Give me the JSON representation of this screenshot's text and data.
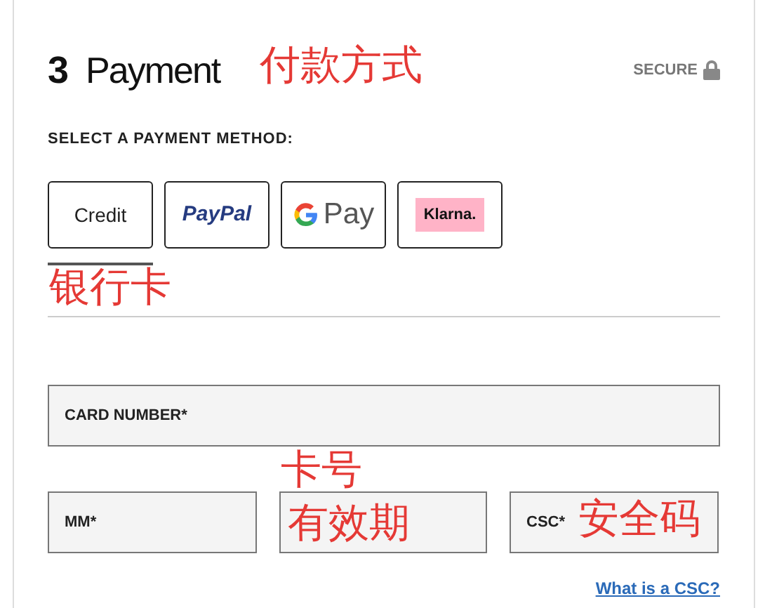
{
  "section": {
    "step": "3",
    "title": "Payment",
    "secure_label": "SECURE"
  },
  "method_prompt": "SELECT A PAYMENT METHOD:",
  "methods": [
    {
      "kind": "credit",
      "label": "Credit",
      "selected": true
    },
    {
      "kind": "paypal",
      "label": "PayPal",
      "selected": false
    },
    {
      "kind": "gpay",
      "label": "Pay",
      "selected": false
    },
    {
      "kind": "klarna",
      "label": "Klarna.",
      "selected": false
    }
  ],
  "fields": {
    "card_number": {
      "placeholder": "CARD NUMBER*"
    },
    "month": {
      "placeholder": "MM*"
    },
    "cvc": {
      "placeholder": "CSC*"
    }
  },
  "help_link": "What is a CSC?",
  "annotations": [
    "付款方式",
    "银行卡",
    "卡号",
    "有效期",
    "安全码"
  ]
}
